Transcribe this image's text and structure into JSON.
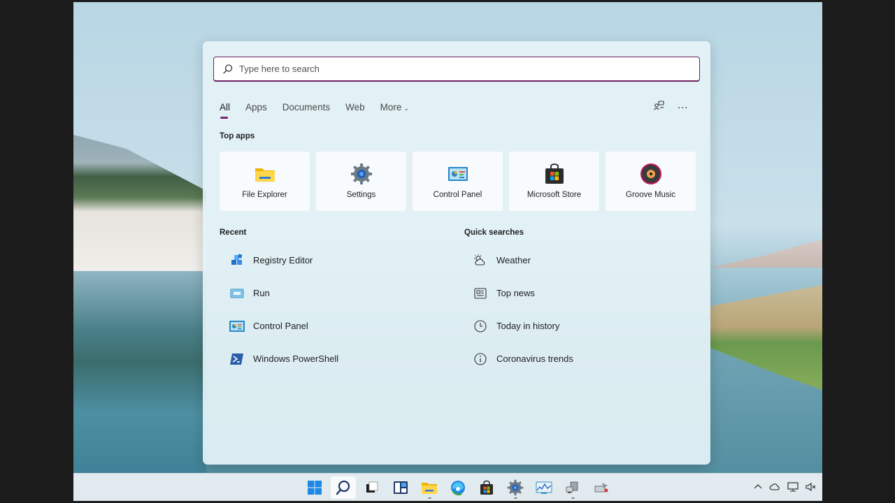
{
  "search": {
    "placeholder": "Type here to search"
  },
  "tabs": [
    {
      "label": "All"
    },
    {
      "label": "Apps"
    },
    {
      "label": "Documents"
    },
    {
      "label": "Web"
    },
    {
      "label": "More"
    }
  ],
  "tools": {
    "more_options": "…"
  },
  "top_apps": {
    "title": "Top apps",
    "items": [
      {
        "label": "File Explorer",
        "icon": "folder-icon"
      },
      {
        "label": "Settings",
        "icon": "gear-icon"
      },
      {
        "label": "Control Panel",
        "icon": "control-panel-icon"
      },
      {
        "label": "Microsoft Store",
        "icon": "store-bag-icon"
      },
      {
        "label": "Groove Music",
        "icon": "music-disc-icon"
      }
    ]
  },
  "recent": {
    "title": "Recent",
    "items": [
      {
        "label": "Registry Editor",
        "icon": "registry-cubes-icon"
      },
      {
        "label": "Run",
        "icon": "run-window-icon"
      },
      {
        "label": "Control Panel",
        "icon": "control-panel-icon"
      },
      {
        "label": "Windows PowerShell",
        "icon": "powershell-icon"
      }
    ]
  },
  "quick_searches": {
    "title": "Quick searches",
    "items": [
      {
        "label": "Weather",
        "icon": "cloud-sun-icon"
      },
      {
        "label": "Top news",
        "icon": "newspaper-icon"
      },
      {
        "label": "Today in history",
        "icon": "clock-icon"
      },
      {
        "label": "Coronavirus trends",
        "icon": "info-icon"
      }
    ]
  },
  "colors": {
    "accent": "#7a2270",
    "search_border": "#6b1f5e"
  }
}
